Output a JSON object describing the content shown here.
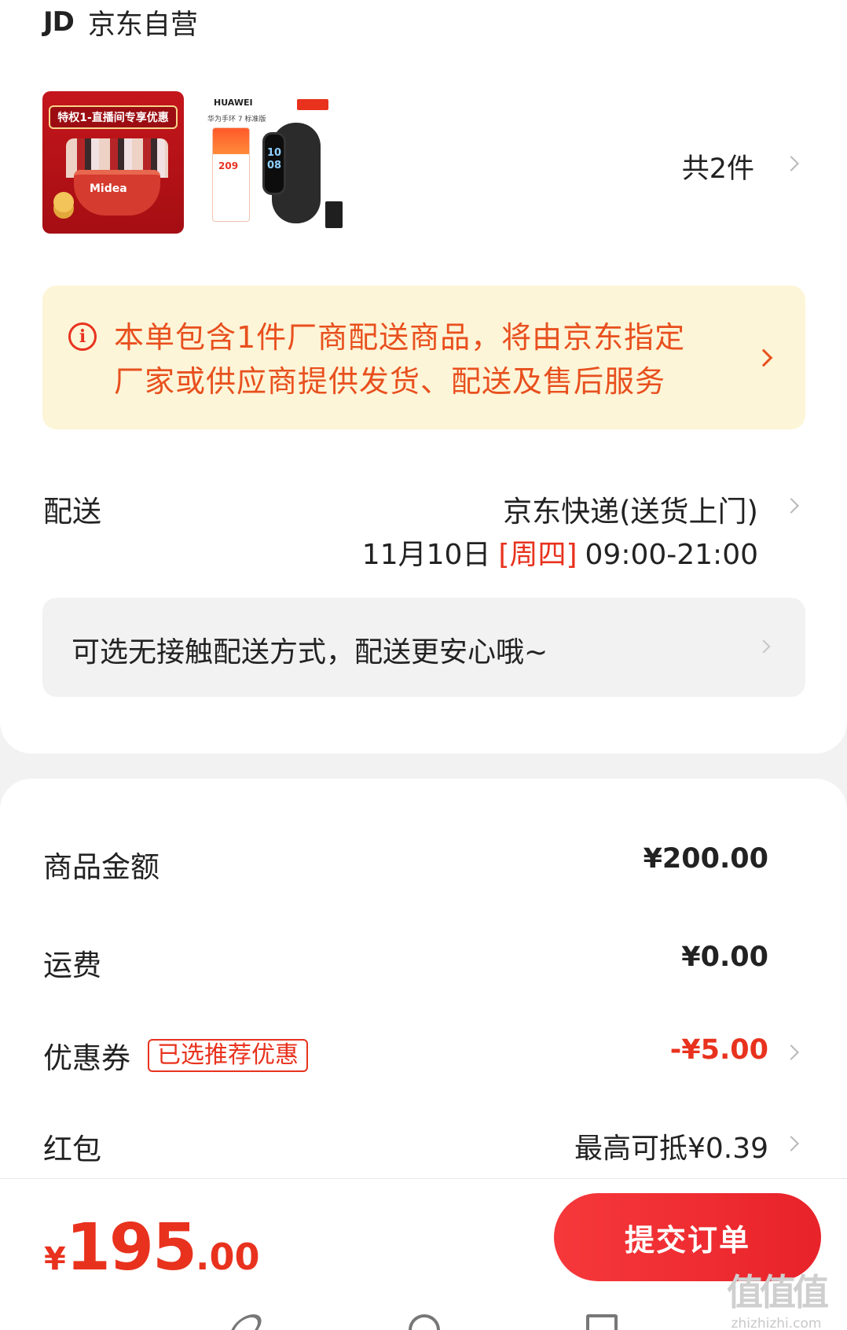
{
  "shop": {
    "logo": "JD",
    "name": "京东自营"
  },
  "products": {
    "thumb1_banner": "特权1-直播间专享优惠",
    "thumb1_brand": "Midea",
    "thumb2_brand": "HUAWEI",
    "thumb2_sub": "华为手环 7 标准版",
    "thumb2_price": "209",
    "thumb2_watch": "10 08",
    "count_label": "共2件"
  },
  "notice": {
    "text": "本单包含1件厂商配送商品，将由京东指定厂家或供应商提供发货、配送及售后服务"
  },
  "delivery": {
    "label": "配送",
    "method": "京东快递(送货上门)",
    "date": "11月10日",
    "weekday": "[周四]",
    "window": "09:00-21:00",
    "contactless": "可选无接触配送方式，配送更安心哦~"
  },
  "summary": {
    "goods_label": "商品金额",
    "goods_value": "¥200.00",
    "shipping_label": "运费",
    "shipping_value": "¥0.00",
    "coupon_label": "优惠券",
    "coupon_badge": "已选推荐优惠",
    "coupon_value": "-¥5.00",
    "redpacket_label": "红包",
    "redpacket_value": "最高可抵¥0.39"
  },
  "footer": {
    "currency": "¥",
    "total_int": "195",
    "total_dec": ".00",
    "submit_label": "提交订单",
    "watermark": "值值值",
    "watermark_site": "zhizhizhi.com"
  },
  "colors": {
    "accent": "#e8321e",
    "notice_bg": "#fdf5d8",
    "button": "#f6383b"
  }
}
